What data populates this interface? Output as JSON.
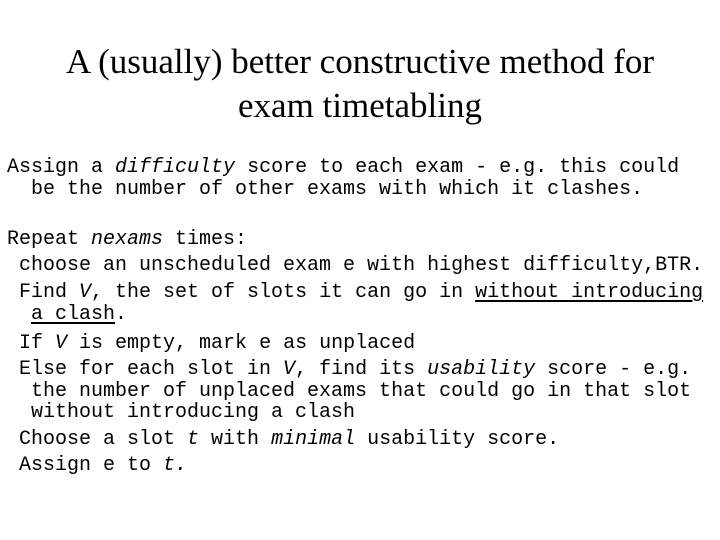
{
  "slide": {
    "title_line1": "A (usually) better constructive method for",
    "title_line2": "exam timetabling",
    "lines": [
      {
        "parts": [
          {
            "t": "Assign a "
          },
          {
            "t": "difficulty",
            "i": true
          },
          {
            "t": " score to each exam - e.g. this could"
          }
        ]
      },
      {
        "parts": [
          {
            "t": "  be the number of other exams with which it clashes."
          }
        ]
      },
      {
        "parts": [
          {
            "t": "Repeat "
          },
          {
            "t": "nexams",
            "i": true
          },
          {
            "t": " times:"
          }
        ]
      },
      {
        "parts": [
          {
            "t": " choose an unscheduled exam e with highest difficulty,BTR."
          }
        ]
      },
      {
        "parts": [
          {
            "t": " Find "
          },
          {
            "t": "V",
            "i": true
          },
          {
            "t": ", the set of slots it can go in "
          },
          {
            "t": "without introducing",
            "u": true
          }
        ]
      },
      {
        "parts": [
          {
            "t": "  "
          },
          {
            "t": "a clash",
            "u": true
          },
          {
            "t": "."
          }
        ]
      },
      {
        "parts": [
          {
            "t": " If "
          },
          {
            "t": "V",
            "i": true
          },
          {
            "t": " is empty, mark e as unplaced"
          }
        ]
      },
      {
        "parts": [
          {
            "t": " Else for each slot in "
          },
          {
            "t": "V",
            "i": true
          },
          {
            "t": ", find its "
          },
          {
            "t": "usability",
            "i": true
          },
          {
            "t": " score - e.g."
          }
        ]
      },
      {
        "parts": [
          {
            "t": "  the number of unplaced exams that could go in that slot"
          }
        ]
      },
      {
        "parts": [
          {
            "t": "  without introducing a clash"
          }
        ]
      },
      {
        "parts": [
          {
            "t": " Choose a slot "
          },
          {
            "t": "t",
            "i": true
          },
          {
            "t": " with "
          },
          {
            "t": "minimal",
            "i": true
          },
          {
            "t": " usability score."
          }
        ]
      },
      {
        "parts": [
          {
            "t": " Assign e to "
          },
          {
            "t": "t.",
            "i": true
          }
        ]
      }
    ]
  }
}
